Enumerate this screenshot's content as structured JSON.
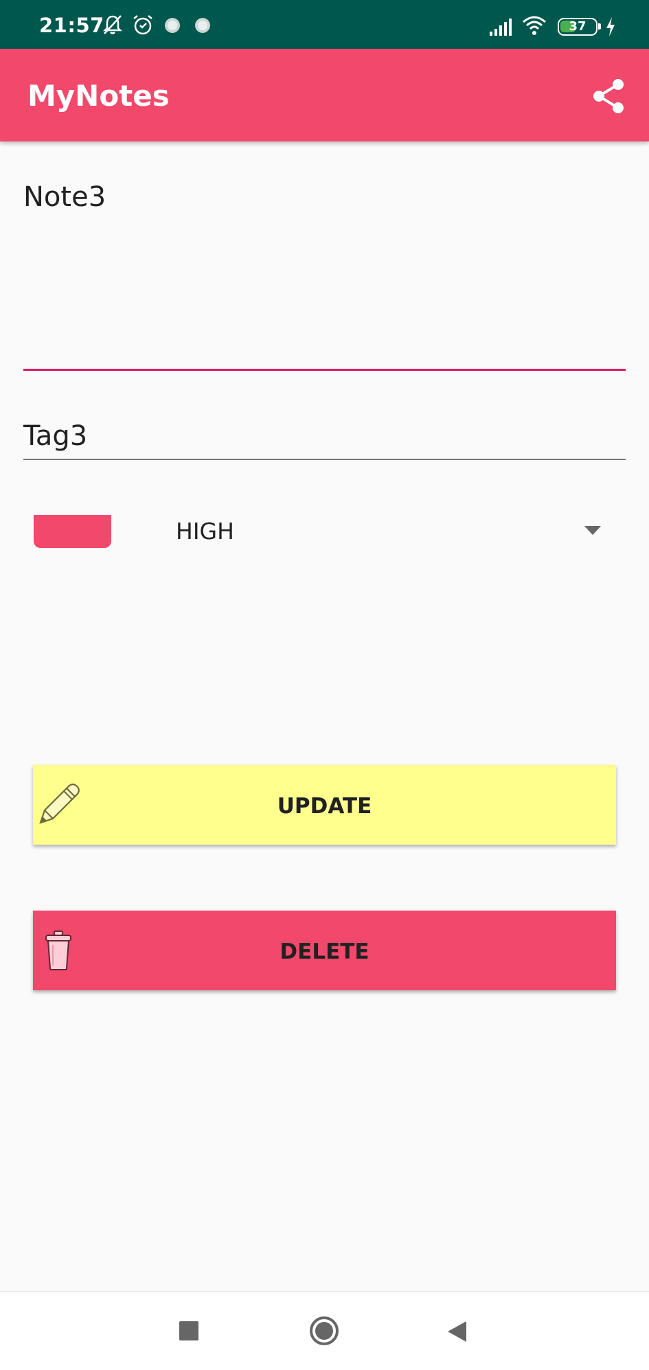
{
  "status_bar": {
    "time": "21:57",
    "battery": "37",
    "icons": [
      "muted-bell-icon",
      "alarm-icon",
      "notification-dot-icon",
      "notification-dot-icon",
      "signal-icon",
      "wifi-icon",
      "battery-icon",
      "charging-icon"
    ]
  },
  "app_bar": {
    "title": "MyNotes",
    "share_icon": "share-icon",
    "color": "#f2486b"
  },
  "form": {
    "note": "Note3",
    "tag": "Tag3",
    "priority": "HIGH",
    "priority_color": "#f2486b",
    "note_underline_color": "#d81b60"
  },
  "buttons": {
    "update_label": "UPDATE",
    "update_icon": "pencil-icon",
    "update_color": "#ffff8d",
    "delete_label": "DELETE",
    "delete_icon": "trash-icon",
    "delete_color": "#f2486b"
  },
  "nav_bar": {
    "icons": [
      "recents-square-icon",
      "home-circle-icon",
      "back-triangle-icon"
    ]
  }
}
